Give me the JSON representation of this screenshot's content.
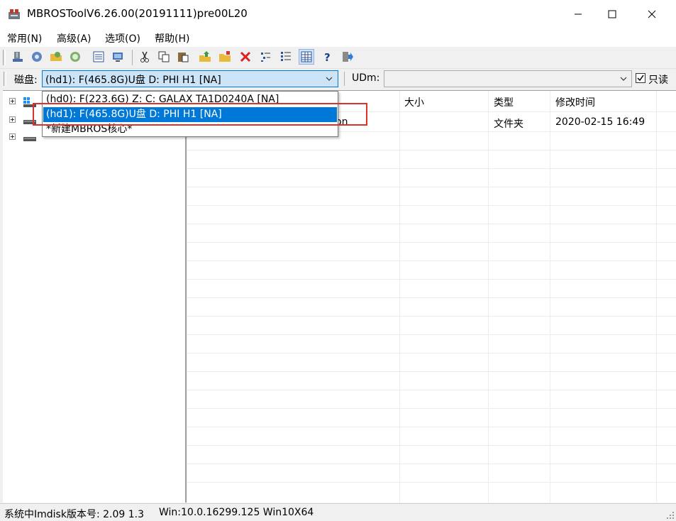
{
  "window": {
    "title": "MBROSToolV6.26.00(20191111)pre00L20"
  },
  "menu": {
    "items": [
      {
        "label": "常用(N)"
      },
      {
        "label": "高级(A)"
      },
      {
        "label": "选项(O)"
      },
      {
        "label": "帮助(H)"
      }
    ]
  },
  "toolbar": {
    "icons": [
      "disk-icon",
      "gear-icon",
      "folder-open-icon",
      "refresh-icon",
      "list-icon",
      "monitor-icon",
      "cut-icon",
      "copy-icon",
      "paste-icon",
      "import-icon",
      "new-folder-icon",
      "delete-icon",
      "tree-small-icon",
      "tree-detail-icon",
      "grid-view-icon",
      "help-icon",
      "exit-icon"
    ]
  },
  "diskbar": {
    "label": "磁盘:",
    "selected": "(hd1): F(465.8G)U盘  D: PHI  H1 [NA]",
    "udm_label": "UDm:",
    "udm_value": "",
    "readonly_label": "只读",
    "readonly_checked": true
  },
  "dropdown": {
    "options": [
      {
        "label": "(hd0): F(223.6G)  Z: C: GALAX TA1D0240A  [NA]",
        "selected": false
      },
      {
        "label": "(hd1): F(465.8G)U盘  D: PHI  H1 [NA]",
        "selected": true
      },
      {
        "label": "*新建MBROS核心*",
        "selected": false
      }
    ]
  },
  "list": {
    "columns": [
      "大小",
      "类型",
      "修改时间"
    ],
    "rows": [
      {
        "name_partial": "on",
        "size": "",
        "type": "文件夹",
        "modified": "2020-02-15 16:49"
      }
    ]
  },
  "status": {
    "imdisk": "系统中Imdisk版本号: 2.09 1.3",
    "os": "Win:10.0.16299.125 Win10X64"
  },
  "colors": {
    "accent": "#0078d7",
    "annotation": "#d9332d",
    "selection_bg": "#cce4f7"
  }
}
